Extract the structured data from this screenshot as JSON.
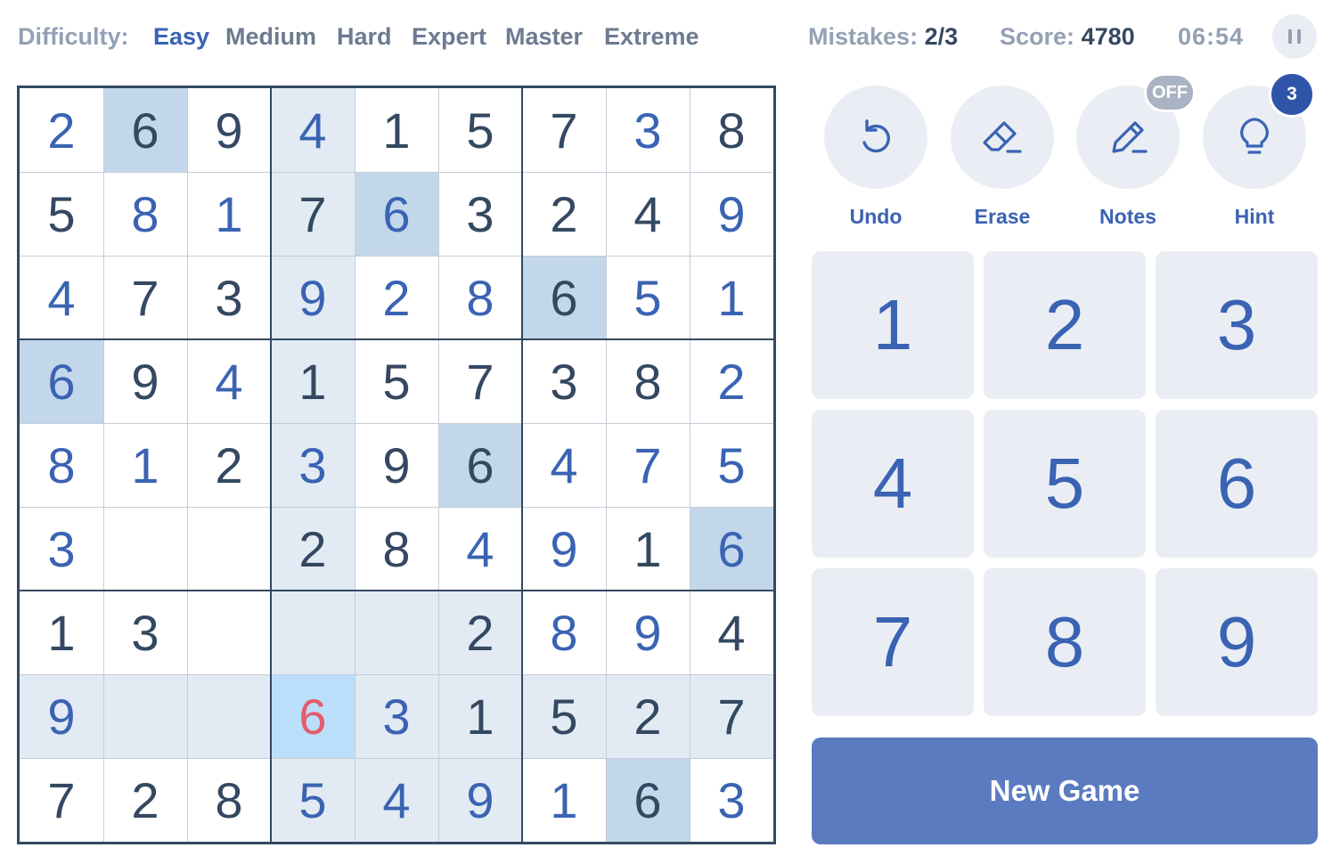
{
  "difficulty": {
    "label": "Difficulty:",
    "options": [
      "Easy",
      "Medium",
      "Hard",
      "Expert",
      "Master",
      "Extreme"
    ],
    "selected": "Easy"
  },
  "stats": {
    "mistakes_label": "Mistakes:",
    "mistakes_value": "2/3",
    "score_label": "Score:",
    "score_value": "4780",
    "timer": "06:54"
  },
  "board": {
    "values": [
      [
        "2",
        "6",
        "9",
        "4",
        "1",
        "5",
        "7",
        "3",
        "8"
      ],
      [
        "5",
        "8",
        "1",
        "7",
        "6",
        "3",
        "2",
        "4",
        "9"
      ],
      [
        "4",
        "7",
        "3",
        "9",
        "2",
        "8",
        "6",
        "5",
        "1"
      ],
      [
        "6",
        "9",
        "4",
        "1",
        "5",
        "7",
        "3",
        "8",
        "2"
      ],
      [
        "8",
        "1",
        "2",
        "3",
        "9",
        "6",
        "4",
        "7",
        "5"
      ],
      [
        "3",
        "",
        "",
        "2",
        "8",
        "4",
        "9",
        "1",
        "6"
      ],
      [
        "1",
        "3",
        "",
        "",
        "",
        "2",
        "8",
        "9",
        "4"
      ],
      [
        "9",
        "",
        "",
        "6",
        "3",
        "1",
        "5",
        "2",
        "7"
      ],
      [
        "7",
        "2",
        "8",
        "5",
        "4",
        "9",
        "1",
        "6",
        "3"
      ]
    ],
    "types": [
      [
        "u",
        "g",
        "g",
        "u",
        "g",
        "g",
        "g",
        "u",
        "g"
      ],
      [
        "g",
        "u",
        "u",
        "g",
        "u",
        "g",
        "g",
        "g",
        "u"
      ],
      [
        "u",
        "g",
        "g",
        "u",
        "u",
        "u",
        "g",
        "u",
        "u"
      ],
      [
        "u",
        "g",
        "u",
        "g",
        "g",
        "g",
        "g",
        "g",
        "u"
      ],
      [
        "u",
        "u",
        "g",
        "u",
        "g",
        "g",
        "u",
        "u",
        "u"
      ],
      [
        "u",
        "",
        "",
        "g",
        "g",
        "u",
        "u",
        "g",
        "u"
      ],
      [
        "g",
        "g",
        "",
        "",
        "",
        "g",
        "u",
        "u",
        "g"
      ],
      [
        "u",
        "",
        "",
        "e",
        "u",
        "g",
        "g",
        "g",
        "g"
      ],
      [
        "g",
        "g",
        "g",
        "u",
        "u",
        "u",
        "u",
        "g",
        "u"
      ]
    ],
    "selected_cell": [
      7,
      3
    ],
    "colors": {
      "given": "#344861",
      "user": "#3a63b3",
      "error": "#e55c6c",
      "highlight_area": "#e2ebf3",
      "same_number": "#c3d7ea",
      "selected": "#bbdefb"
    }
  },
  "tools": [
    {
      "label": "Undo",
      "icon": "undo-icon"
    },
    {
      "label": "Erase",
      "icon": "eraser-icon"
    },
    {
      "label": "Notes",
      "icon": "pencil-icon",
      "badge": "OFF"
    },
    {
      "label": "Hint",
      "icon": "lightbulb-icon",
      "badge": "3"
    }
  ],
  "numpad": [
    "1",
    "2",
    "3",
    "4",
    "5",
    "6",
    "7",
    "8",
    "9"
  ],
  "new_game_label": "New Game"
}
